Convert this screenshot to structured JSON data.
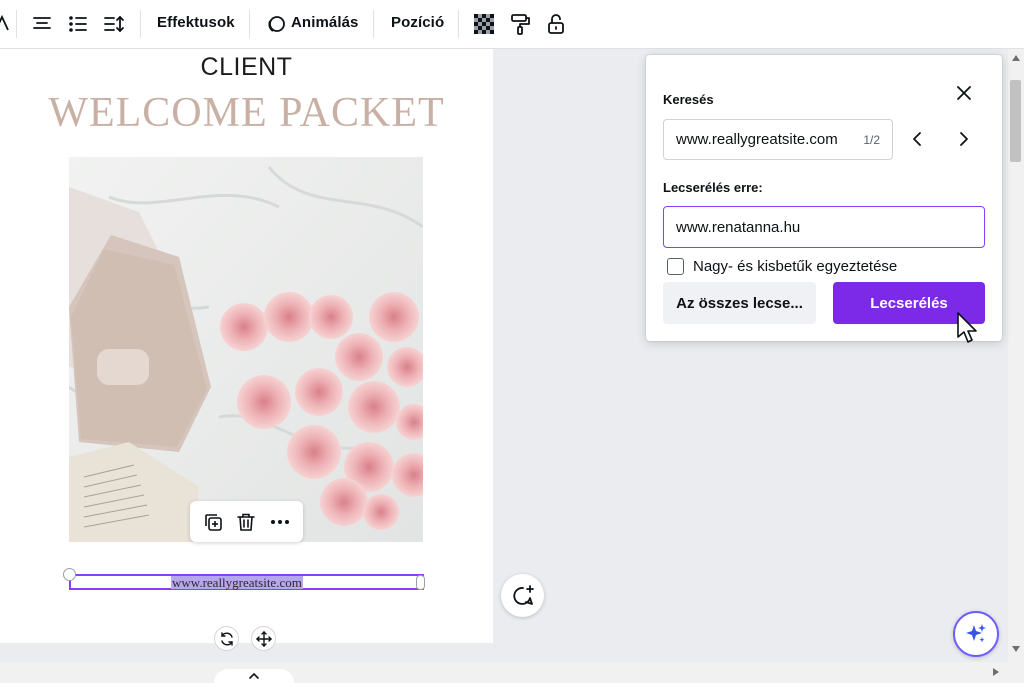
{
  "toolbar": {
    "effects_label": "Effektusok",
    "animate_label": "Animálás",
    "position_label": "Pozíció",
    "icons": [
      "text-size-icon",
      "align-center-icon",
      "list-icon",
      "line-spacing-icon",
      "animate-icon",
      "transparency-icon",
      "copy-style-icon",
      "lock-icon"
    ]
  },
  "design": {
    "client_text": "CLIENT",
    "welcome_text": "WELCOME PACKET",
    "selected_text": "www.reallygreatsite.com",
    "accent_color": "#8b3dff",
    "title_color": "#c9b0a5"
  },
  "action_bar": {
    "icons": [
      "duplicate-icon",
      "trash-icon",
      "more-icon"
    ]
  },
  "find_replace": {
    "search_label": "Keresés",
    "search_value": "www.reallygreatsite.com",
    "match_count": "1/2",
    "replace_label": "Lecserélés erre:",
    "replace_value": "www.renatanna.hu",
    "match_case_label": "Nagy- és kisbetűk egyeztetése",
    "match_case_checked": false,
    "replace_all_label": "Az összes lecse...",
    "replace_label_button": "Lecserélés",
    "primary_color": "#7d2ae8"
  }
}
